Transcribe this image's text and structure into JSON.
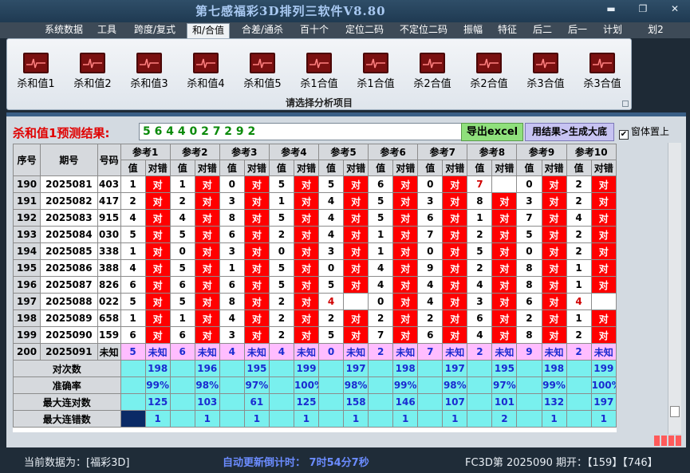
{
  "window": {
    "title": "第七感福彩3D排列三软件V8.80",
    "minimize": "▬",
    "maximize": "❐",
    "close": "✕"
  },
  "menu": [
    "系统数据",
    "工具",
    "跨度/复式",
    "和/合值",
    "合差/通杀",
    "百十个",
    "定位二码",
    "不定位二码",
    "振幅",
    "特征",
    "后二",
    "后一",
    "计划",
    "划2"
  ],
  "menu_active": "和/合值",
  "ribbon": {
    "buttons": [
      "杀和值1",
      "杀和值2",
      "杀和值3",
      "杀和值4",
      "杀和值5",
      "杀1合值",
      "杀1合值",
      "杀2合值",
      "杀2合值",
      "杀3合值",
      "杀3合值"
    ],
    "caption": "请选择分析项目"
  },
  "prediction": {
    "label": "杀和值1预测结果:",
    "value": "5 6 4 4 0 2 7 2 9 2"
  },
  "buttons": {
    "excel": "导出excel",
    "generate": "用结果>生成大底",
    "pin_checkbox": "窗体置上",
    "pin_checked": "✔"
  },
  "table": {
    "headers": {
      "seq": "序号",
      "period": "期号",
      "number": "号码",
      "refs": [
        "参考1",
        "参考2",
        "参考3",
        "参考4",
        "参考5",
        "参考6",
        "参考7",
        "参考8",
        "参考9",
        "参考10"
      ],
      "val": "值",
      "result": "对错"
    },
    "rows": [
      {
        "seq": "190",
        "period": "2025081",
        "num": "403",
        "vals": [
          "1",
          "1",
          "0",
          "5",
          "5",
          "6",
          "0",
          "7",
          "0",
          "2"
        ],
        "res": [
          "对",
          "对",
          "对",
          "对",
          "对",
          "对",
          "对",
          "",
          "对",
          "对"
        ]
      },
      {
        "seq": "191",
        "period": "2025082",
        "num": "417",
        "vals": [
          "2",
          "2",
          "3",
          "1",
          "4",
          "5",
          "3",
          "8",
          "3",
          "2"
        ],
        "res": [
          "对",
          "对",
          "对",
          "对",
          "对",
          "对",
          "对",
          "对",
          "对",
          "对"
        ]
      },
      {
        "seq": "192",
        "period": "2025083",
        "num": "915",
        "vals": [
          "4",
          "4",
          "8",
          "5",
          "4",
          "5",
          "6",
          "1",
          "7",
          "4"
        ],
        "res": [
          "对",
          "对",
          "对",
          "对",
          "对",
          "对",
          "对",
          "对",
          "对",
          "对"
        ]
      },
      {
        "seq": "193",
        "period": "2025084",
        "num": "030",
        "vals": [
          "5",
          "5",
          "6",
          "2",
          "4",
          "1",
          "7",
          "2",
          "5",
          "2"
        ],
        "res": [
          "对",
          "对",
          "对",
          "对",
          "对",
          "对",
          "对",
          "对",
          "对",
          "对"
        ]
      },
      {
        "seq": "194",
        "period": "2025085",
        "num": "338",
        "vals": [
          "1",
          "0",
          "3",
          "0",
          "3",
          "1",
          "0",
          "5",
          "0",
          "2"
        ],
        "res": [
          "对",
          "对",
          "对",
          "对",
          "对",
          "对",
          "对",
          "对",
          "对",
          "对"
        ]
      },
      {
        "seq": "195",
        "period": "2025086",
        "num": "388",
        "vals": [
          "4",
          "5",
          "1",
          "5",
          "0",
          "4",
          "9",
          "2",
          "8",
          "1"
        ],
        "res": [
          "对",
          "对",
          "对",
          "对",
          "对",
          "对",
          "对",
          "对",
          "对",
          "对"
        ]
      },
      {
        "seq": "196",
        "period": "2025087",
        "num": "826",
        "vals": [
          "6",
          "6",
          "6",
          "5",
          "5",
          "4",
          "4",
          "4",
          "8",
          "1"
        ],
        "res": [
          "对",
          "对",
          "对",
          "对",
          "对",
          "对",
          "对",
          "对",
          "对",
          "对"
        ]
      },
      {
        "seq": "197",
        "period": "2025088",
        "num": "022",
        "vals": [
          "5",
          "5",
          "8",
          "2",
          "4",
          "0",
          "4",
          "3",
          "6",
          "4"
        ],
        "res": [
          "对",
          "对",
          "对",
          "对",
          "",
          "对",
          "对",
          "对",
          "对",
          ""
        ]
      },
      {
        "seq": "198",
        "period": "2025089",
        "num": "658",
        "vals": [
          "1",
          "1",
          "4",
          "2",
          "2",
          "2",
          "2",
          "6",
          "2",
          "1"
        ],
        "res": [
          "对",
          "对",
          "对",
          "对",
          "对",
          "对",
          "对",
          "对",
          "对",
          "对"
        ]
      },
      {
        "seq": "199",
        "period": "2025090",
        "num": "159",
        "vals": [
          "6",
          "6",
          "3",
          "2",
          "5",
          "7",
          "6",
          "4",
          "8",
          "2"
        ],
        "res": [
          "对",
          "对",
          "对",
          "对",
          "对",
          "对",
          "对",
          "对",
          "对",
          "对"
        ]
      },
      {
        "seq": "200",
        "period": "2025091",
        "num": "未知",
        "vals": [
          "5",
          "6",
          "4",
          "4",
          "0",
          "2",
          "7",
          "2",
          "9",
          "2"
        ],
        "res": [
          "未知",
          "未知",
          "未知",
          "未知",
          "未知",
          "未知",
          "未知",
          "未知",
          "未知",
          "未知"
        ]
      }
    ],
    "miss_marks": [
      {
        "row": 0,
        "ref": 7
      },
      {
        "row": 7,
        "ref": 4
      },
      {
        "row": 7,
        "ref": 9
      }
    ],
    "stats": [
      {
        "label": "对次数",
        "values": [
          "198",
          "196",
          "195",
          "199",
          "197",
          "198",
          "197",
          "195",
          "198",
          "199"
        ]
      },
      {
        "label": "准确率",
        "values": [
          "99%",
          "98%",
          "97%",
          "100%",
          "98%",
          "99%",
          "98%",
          "97%",
          "99%",
          "100%"
        ]
      },
      {
        "label": "最大连对数",
        "values": [
          "125",
          "103",
          "61",
          "125",
          "158",
          "146",
          "107",
          "101",
          "132",
          "197"
        ]
      },
      {
        "label": "最大连错数",
        "values": [
          "1",
          "1",
          "1",
          "1",
          "1",
          "1",
          "1",
          "2",
          "1",
          "1"
        ]
      }
    ]
  },
  "status": {
    "current": "当前数据为：[福彩3D]",
    "countdown_label": "自动更新倒计时：",
    "countdown_value": "7时54分7秒",
    "info": "FC3D第 2025090 期开：【159】【746】"
  }
}
